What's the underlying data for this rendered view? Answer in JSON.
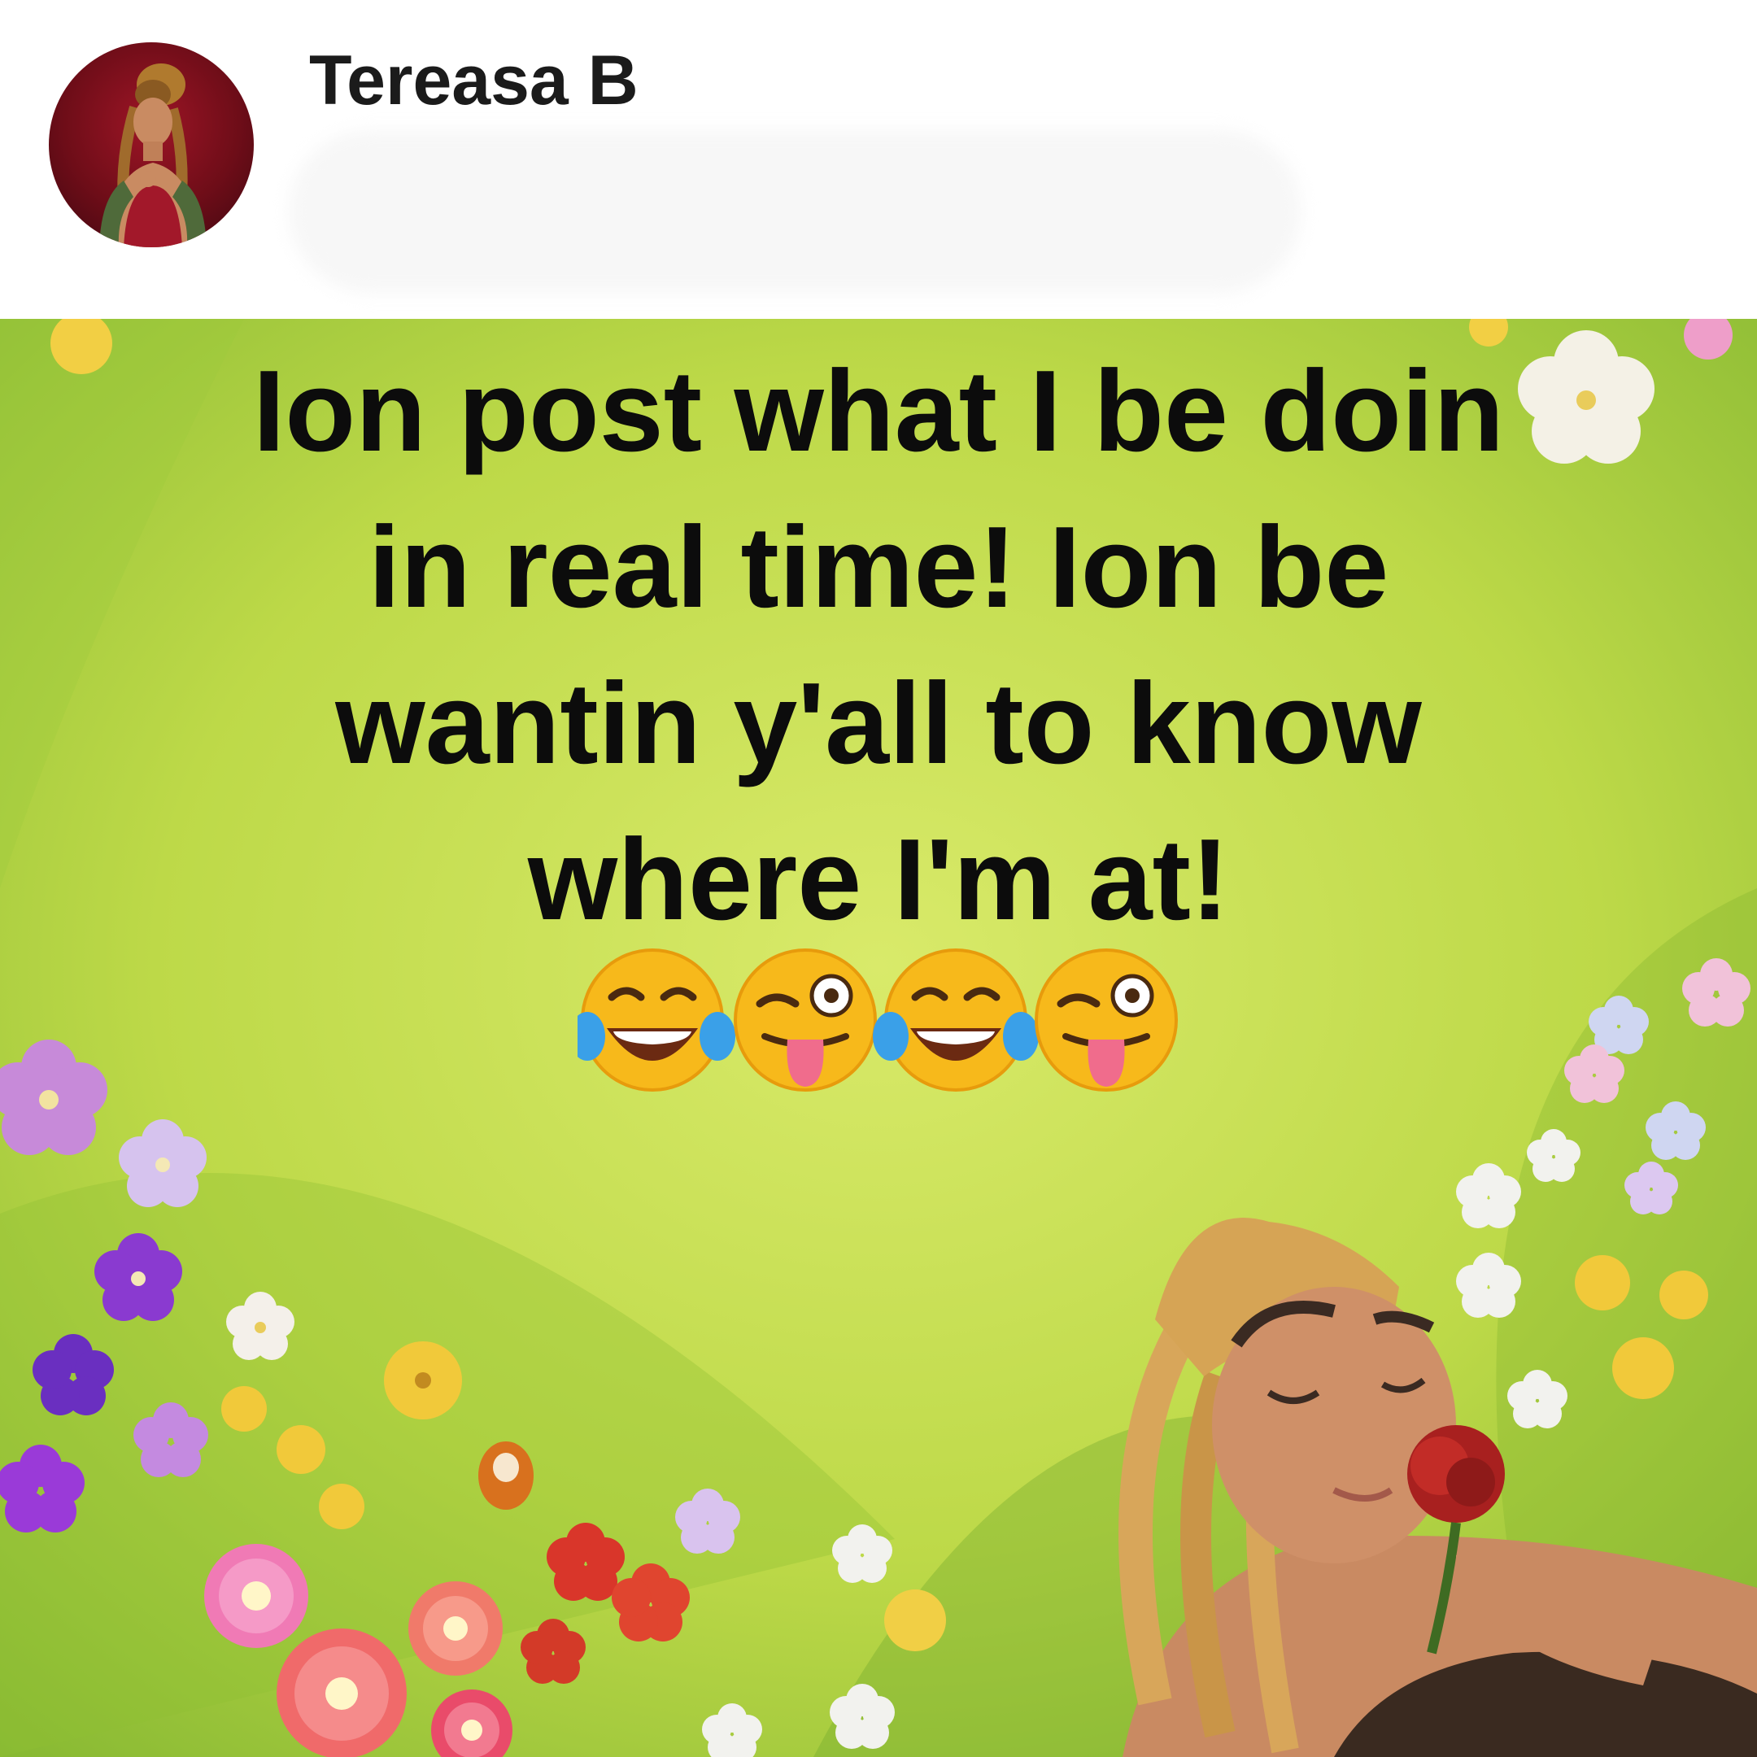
{
  "post": {
    "author_name": "Tereasa B",
    "meme_text": "Ion post what I be doin in real time! Ion be wantin y'all to know where I'm at!"
  },
  "emojis": [
    {
      "name": "face-with-tears-of-joy-icon"
    },
    {
      "name": "winking-face-with-tongue-icon"
    },
    {
      "name": "face-with-tears-of-joy-icon"
    },
    {
      "name": "winking-face-with-tongue-icon"
    }
  ],
  "colors": {
    "background_green": "#c8e04a",
    "text": "#0c0c0c",
    "emoji_yellow": "#f7b91b"
  }
}
